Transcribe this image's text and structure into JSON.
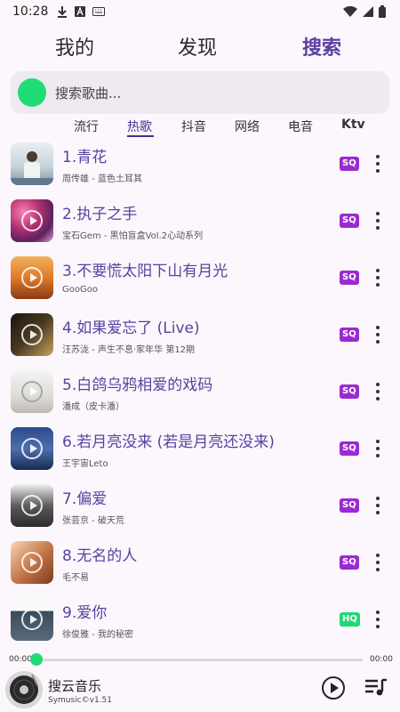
{
  "status": {
    "time": "10:28",
    "left_icons": [
      "download-icon",
      "font-a-icon",
      "keyboard-icon"
    ],
    "right_icons": [
      "wifi-icon",
      "signal-icon",
      "battery-icon"
    ]
  },
  "top_tabs": [
    {
      "label": "我的",
      "active": false
    },
    {
      "label": "发现",
      "active": false
    },
    {
      "label": "搜索",
      "active": true
    }
  ],
  "search": {
    "placeholder": "搜索歌曲..."
  },
  "category_tabs": [
    {
      "label": "流行",
      "active": false
    },
    {
      "label": "热歌",
      "active": true
    },
    {
      "label": "抖音",
      "active": false
    },
    {
      "label": "网络",
      "active": false
    },
    {
      "label": "电音",
      "active": false
    },
    {
      "label": "Ktv",
      "active": false
    }
  ],
  "songs": [
    {
      "title": "1.青花",
      "subtitle": "周传雄 - 蓝色土耳其",
      "quality": "SQ"
    },
    {
      "title": "2.执子之手",
      "subtitle": "宝石Gem - 黑怕盲盒Vol.2心动系列",
      "quality": "SQ"
    },
    {
      "title": "3.不要慌太阳下山有月光",
      "subtitle": "GooGoo",
      "quality": "SQ"
    },
    {
      "title": "4.如果爱忘了 (Live)",
      "subtitle": "汪苏泷 - 声生不息·家年华 第12期",
      "quality": "SQ"
    },
    {
      "title": "5.白鸽乌鸦相爱的戏码",
      "subtitle": "潘成（皮卡潘）",
      "quality": "SQ"
    },
    {
      "title": "6.若月亮没来 (若是月亮还没来)",
      "subtitle": "王宇宙Leto",
      "quality": "SQ"
    },
    {
      "title": "7.偏爱",
      "subtitle": "张芸京 - 破天荒",
      "quality": "SQ"
    },
    {
      "title": "8.无名的人",
      "subtitle": "毛不易",
      "quality": "SQ"
    },
    {
      "title": "9.爱你",
      "subtitle": "徐俊雅 - 我的秘密",
      "quality": "HQ"
    }
  ],
  "colors": {
    "accent": "#5b3fa0",
    "green": "#1fdd74",
    "sq_badge": "#9a2bd0",
    "hq_badge": "#1fd873"
  },
  "progress": {
    "current": "00:00",
    "total": "00:00",
    "fraction": 0.0
  },
  "player": {
    "title": "搜云音乐",
    "subtitle": "Symusic©v1.51"
  }
}
